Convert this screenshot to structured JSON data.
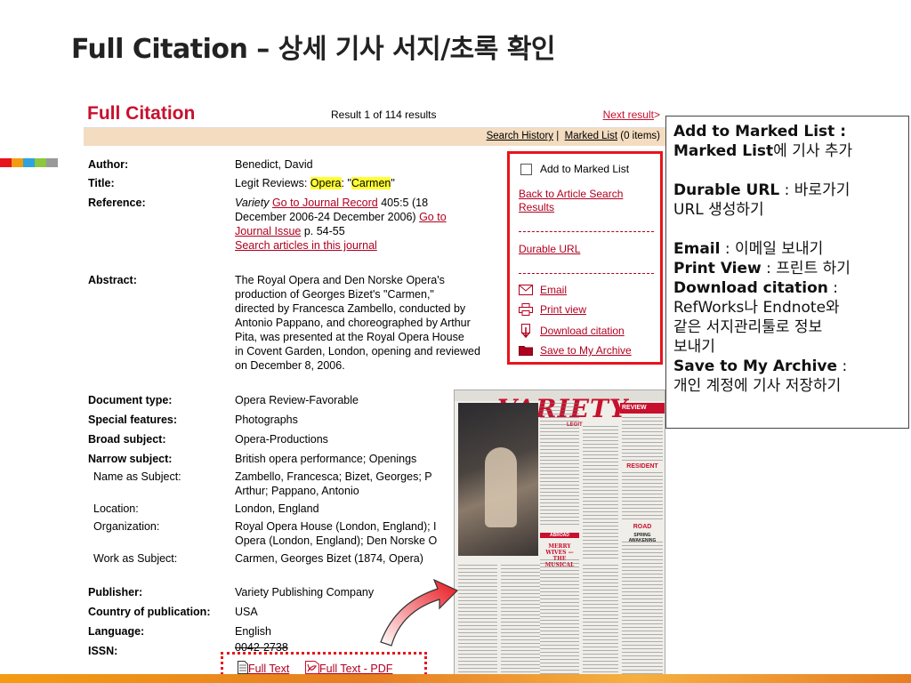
{
  "slide": {
    "title": "Full Citation – 상세 기사 서지/초록 확인",
    "strip_colors": [
      "#e8141c",
      "#f39c12",
      "#2ea3dc",
      "#8dc63f",
      "#999999"
    ]
  },
  "citation": {
    "heading": "Full Citation",
    "result_text": "Result 1 of 114 results",
    "next_label": "Next result",
    "next_arrow": ">",
    "nav": {
      "search_history": "Search History",
      "separator": "|",
      "marked_list": "Marked List",
      "marked_count": "(0 items)"
    },
    "fields": {
      "author_label": "Author:",
      "author_value": "Benedict, David",
      "title_label": "Title:",
      "title_pre": "Legit Reviews: ",
      "title_hl1": "Opera",
      "title_mid": ": \"",
      "title_hl2": "Carmen",
      "title_post": "\"",
      "reference_label": "Reference:",
      "ref_journal": "Variety",
      "ref_link1": "Go to Journal Record",
      "ref_vol": " 405:5 (18",
      "ref_dates": "December 2006-24 December 2006)",
      "ref_link2": "Go to",
      "ref_link2b": "Journal Issue",
      "ref_pages": " p. 54-55",
      "ref_link3": "Search articles in this journal",
      "abstract_label": "Abstract:",
      "abstract_l1": "The Royal Opera and Den Norske Opera's",
      "abstract_l2": "production of Georges Bizet's \"Carmen,\"",
      "abstract_l3": "directed by Francesca Zambello, conducted by",
      "abstract_l4": "Antonio Pappano, and choreographed by Arthur",
      "abstract_l5": "Pita, was presented at the Royal Opera House",
      "abstract_l6": "in Covent Garden, London, opening and reviewed",
      "abstract_l7": "on December 8, 2006.",
      "doctype_label": "Document type:",
      "doctype_value": "Opera Review-Favorable",
      "special_label": "Special features:",
      "special_value": "Photographs",
      "broad_label": "Broad subject:",
      "broad_value": "Opera-Productions",
      "narrow_label": "Narrow subject:",
      "narrow_value": "British opera performance; Openings",
      "name_label": "Name as Subject:",
      "name_l1": "Zambello, Francesca; Bizet, Georges; P",
      "name_l2": "Arthur; Pappano, Antonio",
      "location_label": "Location:",
      "location_value": "London, England",
      "org_label": "Organization:",
      "org_l1": "Royal Opera House (London, England); I",
      "org_l2": "Opera (London, England); Den Norske O",
      "work_label": "Work as Subject:",
      "work_value": "Carmen, Georges Bizet (1874, Opera)",
      "publisher_label": "Publisher:",
      "publisher_value": "Variety Publishing Company",
      "country_label": "Country of publication:",
      "country_value": "USA",
      "language_label": "Language:",
      "language_value": "English",
      "issn_label": "ISSN:",
      "issn_value": "0042-2738"
    },
    "actions": {
      "add_marked": "Add to Marked List",
      "back_l1": "Back to Article Search",
      "back_l2": "Results",
      "durable": "Durable URL",
      "email": "Email",
      "print": "Print view",
      "download": "Download citation",
      "save": "Save to My Archive"
    },
    "fulltext": {
      "html": "Full Text",
      "pdf": "Full Text - PDF"
    }
  },
  "magazine": {
    "logo": "VARIETY",
    "logo_sub": "LEGIT",
    "review_tag": "REVIEW",
    "abroad": "ABROAD",
    "headline1": "MERRY WIVES —",
    "headline2": "THE MUSICAL",
    "road": "ROAD",
    "spring": "SPRING AWAKENING",
    "resident": "RESIDENT"
  },
  "description": {
    "add_b": "Add to Marked List :",
    "add_b2": "Marked List",
    "add_t": "에 기사 추가",
    "durable_b": "Durable URL",
    "durable_t": " : 바로가기",
    "durable_t2": "URL 생성하기",
    "email_b": "Email",
    "email_t": " : 이메일 보내기",
    "print_b": "Print View",
    "print_t": " : 프린트 하기",
    "download_b": "Download citation",
    "download_t": " :",
    "download_t2": "RefWorks나 Endnote와",
    "download_t3": "같은 서지관리툴로 정보",
    "download_t4": "보내기",
    "save_b": "Save to My Archive",
    "save_t": " :",
    "save_t2": "개인 계정에 기사 저장하기"
  }
}
